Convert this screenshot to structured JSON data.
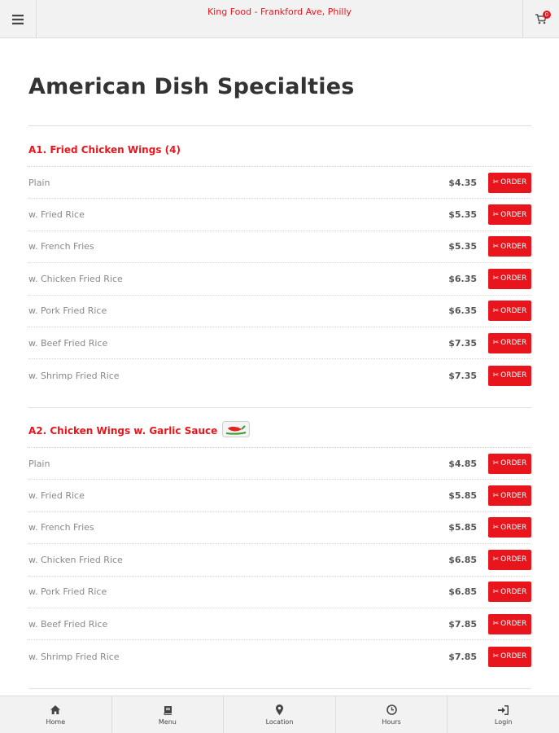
{
  "header": {
    "title": "King Food - Frankford Ave, Philly",
    "menu_icon": "hamburger-icon",
    "cart_icon": "cart-icon",
    "cart_count": "0"
  },
  "page": {
    "title": "American Dish Specialties"
  },
  "sections": [
    {
      "title": "A1. Fried Chicken Wings (4)",
      "spicy": false,
      "items": [
        {
          "name": "Plain",
          "price": "$4.35"
        },
        {
          "name": "w. Fried Rice",
          "price": "$5.35"
        },
        {
          "name": "w. French Fries",
          "price": "$5.35"
        },
        {
          "name": "w. Chicken Fried Rice",
          "price": "$6.35"
        },
        {
          "name": "w. Pork Fried Rice",
          "price": "$6.35"
        },
        {
          "name": "w. Beef Fried Rice",
          "price": "$7.35"
        },
        {
          "name": "w. Shrimp Fried Rice",
          "price": "$7.35"
        }
      ]
    },
    {
      "title": "A2. Chicken Wings w. Garlic Sauce",
      "spicy": true,
      "items": [
        {
          "name": "Plain",
          "price": "$4.85"
        },
        {
          "name": "w. Fried Rice",
          "price": "$5.85"
        },
        {
          "name": "w. French Fries",
          "price": "$5.85"
        },
        {
          "name": "w. Chicken Fried Rice",
          "price": "$6.85"
        },
        {
          "name": "w. Pork Fried Rice",
          "price": "$6.85"
        },
        {
          "name": "w. Beef Fried Rice",
          "price": "$7.85"
        },
        {
          "name": "w. Shrimp Fried Rice",
          "price": "$7.85"
        }
      ]
    }
  ],
  "order_label": "ORDER",
  "bottom_nav": [
    {
      "label": "Home",
      "icon": "home-icon"
    },
    {
      "label": "Menu",
      "icon": "book-icon"
    },
    {
      "label": "Location",
      "icon": "map-pin-icon"
    },
    {
      "label": "Hours",
      "icon": "clock-icon"
    },
    {
      "label": "Login",
      "icon": "login-icon"
    }
  ],
  "colors": {
    "accent": "#e8161c",
    "bar_bg": "#f2f2f2"
  }
}
